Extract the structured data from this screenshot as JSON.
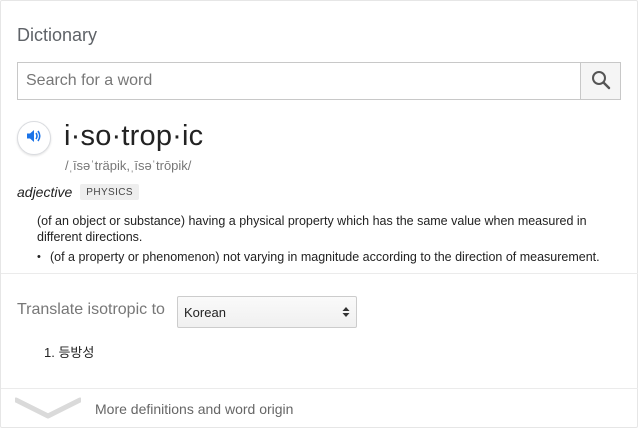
{
  "header": {
    "title": "Dictionary"
  },
  "search": {
    "placeholder": "Search for a word",
    "button_icon": "search-icon"
  },
  "entry": {
    "word": "i·so·trop·ic",
    "phonetic": "/ˌīsəˈträpik,ˌīsəˈtrōpik/",
    "audio_icon": "speaker-icon",
    "part_of_speech": "adjective",
    "domain_badge": "PHYSICS",
    "definitions": [
      "(of an object or substance) having a physical property which has the same value when measured in different directions."
    ],
    "sub_definitions": [
      "(of a property or phenomenon) not varying in magnitude according to the direction of measurement."
    ]
  },
  "translate": {
    "label": "Translate isotropic to",
    "selected_language": "Korean",
    "results": [
      "1. 등방성"
    ]
  },
  "footer": {
    "more_label": "More definitions and word origin",
    "chevron_icon": "chevron-down-icon"
  },
  "colors": {
    "accent_blue": "#1a73e8",
    "muted_text": "#777777",
    "divider": "#ebebeb"
  }
}
